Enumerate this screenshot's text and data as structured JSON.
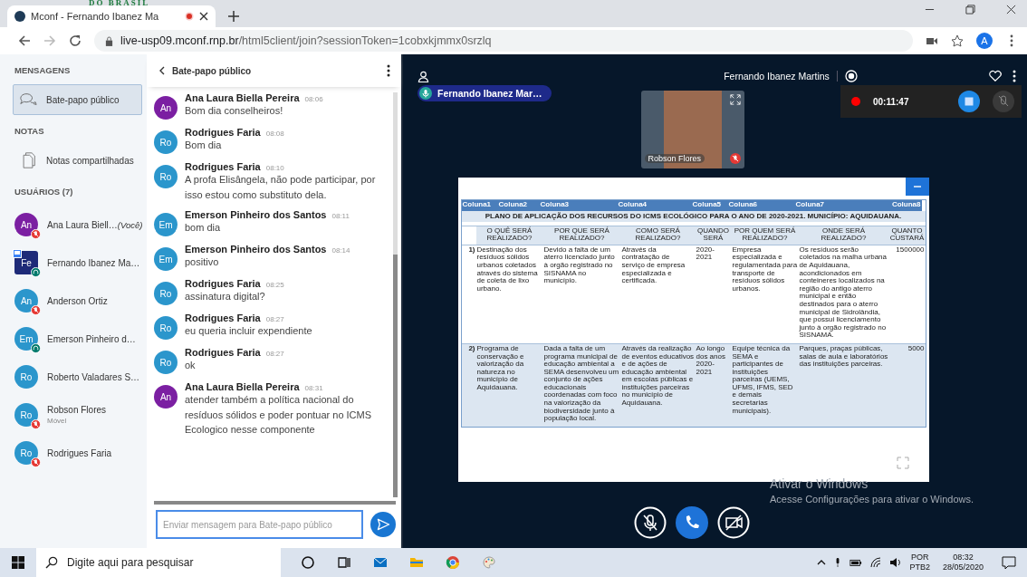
{
  "banner": {
    "text": "DO BRASIL"
  },
  "browser": {
    "tab_title": "Mconf - Fernando Ibanez Ma",
    "url_host": "live-usp09.mconf.rnp.br",
    "url_path": "/html5client/join?sessionToken=1cobxkjmmx0srzlq",
    "profile": "A"
  },
  "sidebar": {
    "messages_heading": "MENSAGENS",
    "public_chat": {
      "label": "Bate-papo público",
      "selected": true
    },
    "notes_heading": "NOTAS",
    "shared_notes": {
      "label": "Notas compartilhadas",
      "selected": false
    },
    "users_heading": "USUÁRIOS (7)",
    "users": [
      {
        "initials": "An",
        "name": "Ana Laura Biell…",
        "suffix": "(Você)",
        "color": "#7b1fa2",
        "kind": "round",
        "muted": true,
        "listening": false
      },
      {
        "initials": "Fe",
        "name": "Fernando Ibanez Ma…",
        "color": "#1e2a78",
        "kind": "presenter",
        "muted": false,
        "listening": true
      },
      {
        "initials": "An",
        "name": "Anderson Ortiz",
        "color": "#2b96cc",
        "kind": "round",
        "muted": true,
        "listening": false
      },
      {
        "initials": "Em",
        "name": "Emerson Pinheiro d…",
        "color": "#2b96cc",
        "kind": "round",
        "muted": false,
        "listening": true
      },
      {
        "initials": "Ro",
        "name": "Roberto Valadares S…",
        "color": "#2b96cc",
        "kind": "round",
        "muted": false,
        "listening": false
      },
      {
        "initials": "Ro",
        "name": "Robson Flores",
        "sub": "Móvel",
        "color": "#2b96cc",
        "kind": "round",
        "muted": true,
        "listening": false
      },
      {
        "initials": "Ro",
        "name": "Rodrigues Faria",
        "color": "#2b96cc",
        "kind": "round",
        "muted": true,
        "listening": false
      }
    ]
  },
  "chat": {
    "title": "Bate-papo público",
    "placeholder": "Enviar mensagem para Bate-papo público",
    "messages": [
      {
        "initials": "An",
        "color": "#7b1fa2",
        "name": "Ana Laura Biella Pereira",
        "time": "08:06",
        "text": "Bom dia conselheiros!"
      },
      {
        "initials": "Ro",
        "color": "#2b96cc",
        "name": "Rodrigues Faria",
        "time": "08:08",
        "text": "Bom dia"
      },
      {
        "initials": "Ro",
        "color": "#2b96cc",
        "name": "Rodrigues Faria",
        "time": "08:10",
        "text": "A profa Elisângela, não pode participar, por isso estou como substituto dela."
      },
      {
        "initials": "Em",
        "color": "#2b96cc",
        "name": "Emerson Pinheiro dos Santos",
        "time": "08:11",
        "text": "bom dia"
      },
      {
        "initials": "Em",
        "color": "#2b96cc",
        "name": "Emerson Pinheiro dos Santos",
        "time": "08:14",
        "text": "positivo"
      },
      {
        "initials": "Ro",
        "color": "#2b96cc",
        "name": "Rodrigues Faria",
        "time": "08:25",
        "text": "assinatura digital?"
      },
      {
        "initials": "Ro",
        "color": "#2b96cc",
        "name": "Rodrigues Faria",
        "time": "08:27",
        "text": "eu queria incluir expendiente"
      },
      {
        "initials": "Ro",
        "color": "#2b96cc",
        "name": "Rodrigues Faria",
        "time": "08:27",
        "text": "ok"
      },
      {
        "initials": "An",
        "color": "#7b1fa2",
        "name": "Ana Laura Biella Pereira",
        "time": "08:31",
        "text": "atender também a política nacional do resíduos sólidos e poder pontuar no ICMS Ecologico nesse componente"
      }
    ]
  },
  "meeting": {
    "title": "Fernando Ibanez Martins",
    "talking": "Fernando Ibanez Mar…",
    "recording": {
      "time": "00:11:47",
      "on": true
    },
    "webcam": {
      "name": "Robson Flores"
    },
    "slide": {
      "columns": [
        "Coluna1",
        "Coluna2",
        "Coluna3",
        "Coluna4",
        "Coluna5",
        "Coluna6",
        "Coluna7",
        "Coluna8"
      ],
      "title": "PLANO DE APLICAÇÃO DOS RECURSOS DO ICMS ECOLÓGICO PARA O ANO DE 2020-2021. MUNICÍPIO: AQUIDAUANA.",
      "headers": [
        "O QUÊ SERÁ REALIZADO?",
        "POR QUE SERÁ REALIZADO?",
        "COMO SERÁ REALIZADO?",
        "QUANDO SERÁ",
        "POR QUEM SERÁ REALIZADO?",
        "ONDE SERÁ REALIZADO?",
        "QUANTO CUSTARÁ"
      ],
      "rows": [
        {
          "cells": [
            "1)",
            "Destinação dos resíduos sólidos urbanos coletados através do sistema de coleta de lixo urbano.",
            "Devido a falta de um aterro licenciado junto à orgão registrado no SISNAMA no município.",
            "Através da contratação de serviço de empresa especializada e certificada.",
            "2020-2021",
            "Empresa especializada e regulamentada para transporte de resíduos sólidos urbanos.",
            "Os resíduos serão coletados na malha urbana de Aquidauana, acondicionados em conteineres localizados na região do antigo aterro municipal e então destinados para o aterro municipal de Sidrolândia, que possui licenciamento junto à orgão registrado no SISNAMA.",
            "1500000"
          ]
        },
        {
          "cells": [
            "2)",
            "Programa de conservação e valorização da natureza no município de Aquidauana.",
            "Dada a falta de um programa municipal de educação ambiental a SEMA desenvolveu um conjunto de ações educacionais coordenadas com foco na valorização da biodiversidade junto à população local.",
            "Através da realização de eventos educativos e de ações de educação ambiental em escolas públicas e instituições parceiras no município de Aquidauana.",
            "Ao longo dos anos 2020-2021",
            "Equipe técnica da SEMA e participantes de instituições parceiras (UEMS, UFMS, IFMS, SED e demais secretarias municipais).",
            "Parques, praças públicas, salas de aula e laboratórios das instituições parceiras.",
            "5000"
          ]
        }
      ]
    },
    "activation": {
      "title": "Ativar o Windows",
      "text": "Acesse Configurações para ativar o Windows."
    }
  },
  "taskbar": {
    "search_placeholder": "Digite aqui para pesquisar",
    "language": "POR",
    "layout": "PTB2",
    "time": "08:32",
    "date": "28/05/2020"
  }
}
